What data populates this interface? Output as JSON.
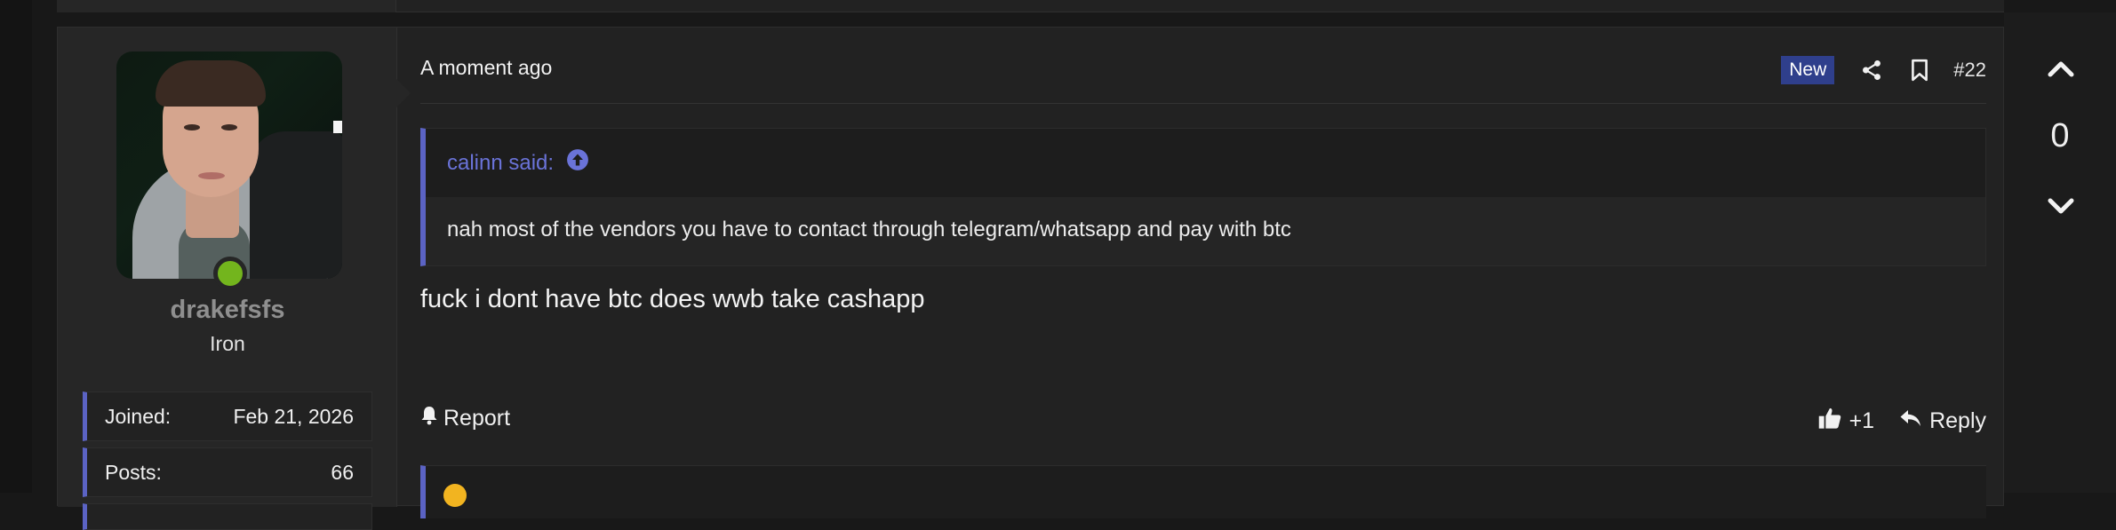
{
  "post": {
    "date": "A moment ago",
    "badge_new": "New",
    "post_number": "#22",
    "icons": {
      "share": "share-icon",
      "bookmark": "bookmark-icon"
    },
    "quote": {
      "author_label": "calinn said:",
      "text": "nah most of the vendors you have to contact through telegram/whatsapp and pay with btc"
    },
    "message": "fuck i dont have btc does wwb take cashapp",
    "actions": {
      "report_label": "Report",
      "reaction_label": "+1",
      "reply_label": "Reply"
    }
  },
  "user": {
    "username": "drakefsfs",
    "title": "Iron",
    "extras": [
      {
        "label": "Joined:",
        "value": "Feb 21, 2026"
      },
      {
        "label": "Posts:",
        "value": "66"
      }
    ],
    "online_color": "#73b51d"
  },
  "vote": {
    "count": "0"
  },
  "colors": {
    "accent": "#5b63c4",
    "quote_link": "#6a73d8",
    "badge_bg": "#2f3f8c"
  }
}
